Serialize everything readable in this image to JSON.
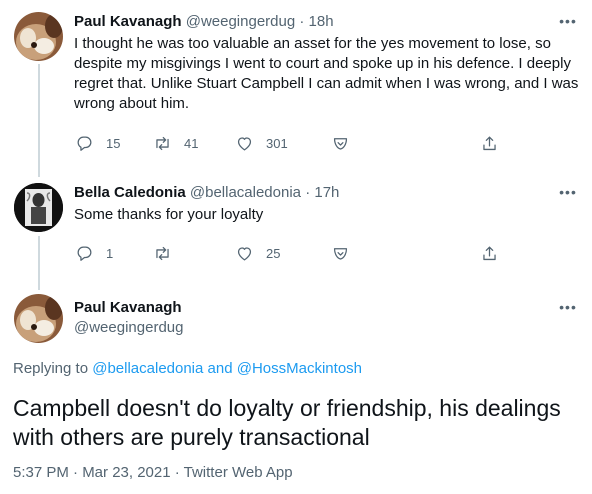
{
  "colors": {
    "text": "#0f1419",
    "secondary": "#536471",
    "link": "#1d9bf0",
    "thread_line": "#cfd9de"
  },
  "tweet1": {
    "author_name": "Paul Kavanagh",
    "author_handle": "@weegingerdug",
    "separator": "·",
    "time": "18h",
    "text": "I thought he was too valuable an asset for the yes movement to lose, so despite my misgivings I went to court and spoke up in his defence. I deeply regret that. Unlike Stuart Campbell I can admit when I was wrong, and I was wrong about him.",
    "reply_count": "15",
    "retweet_count": "41",
    "like_count": "301",
    "icons": [
      "reply-icon",
      "retweet-icon",
      "like-icon",
      "report-icon",
      "share-icon",
      "more-icon"
    ]
  },
  "tweet2": {
    "author_name": "Bella Caledonia",
    "author_handle": "@bellacaledonia",
    "separator": "·",
    "time": "17h",
    "text": "Some thanks for your loyalty",
    "reply_count": "1",
    "retweet_count": "",
    "like_count": "25"
  },
  "main_tweet": {
    "author_name": "Paul Kavanagh",
    "author_handle": "@weegingerdug",
    "replying_prefix": "Replying to",
    "replying_user_1": "@bellacaledonia",
    "replying_and": "and",
    "replying_user_2": "@HossMackintosh",
    "text": "Campbell doesn't do loyalty or friendship, his dealings with others are purely transactional",
    "meta": "5:37 PM · Mar 23, 2021 · Twitter Web App"
  }
}
